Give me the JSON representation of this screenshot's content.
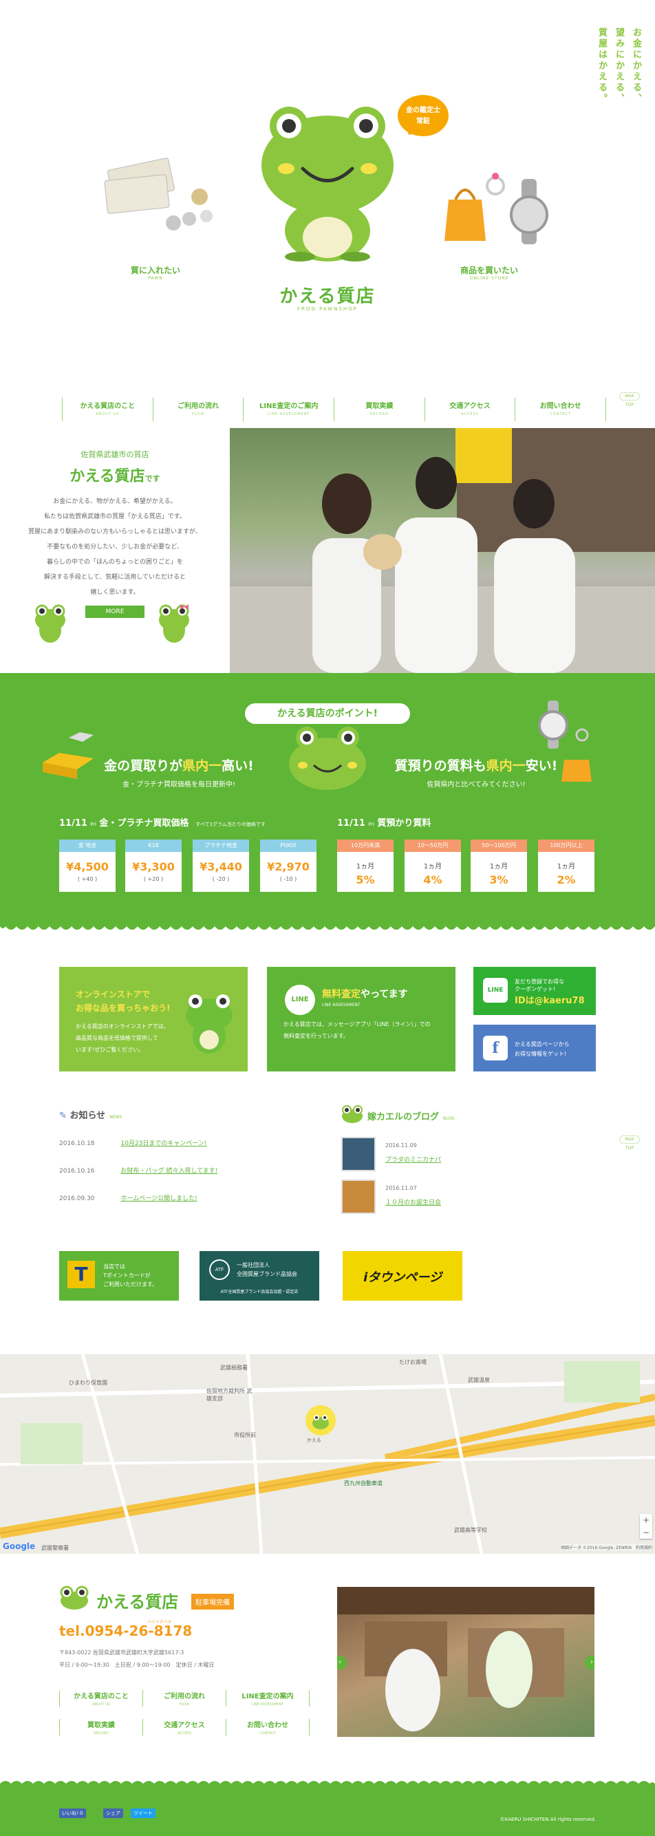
{
  "header": {
    "tagline": [
      "お金にかえる、",
      "望みにかえる、",
      "質屋はかえる。"
    ],
    "bubble": [
      "金の鑑定士",
      "常駐"
    ],
    "logo_title": "かえる質店",
    "logo_sub": "FROG PAWNSHOP",
    "left_link": {
      "label": "質に入れたい",
      "sub": "PAWN"
    },
    "right_link": {
      "label": "商品を買いたい",
      "sub": "ONLINE STORE"
    }
  },
  "nav": [
    {
      "label": "かえる質店のこと",
      "sub": "ABOUT US"
    },
    {
      "label": "ご利用の流れ",
      "sub": "FLOW"
    },
    {
      "label": "LINE査定のご案内",
      "sub": "LINE ASSESSMENT"
    },
    {
      "label": "買取実績",
      "sub": "RECORD"
    },
    {
      "label": "交通アクセス",
      "sub": "ACCESS"
    },
    {
      "label": "お問い合わせ",
      "sub": "CONTACT"
    }
  ],
  "pagetop": {
    "label": "PAGE",
    "sub": "TOP"
  },
  "intro": {
    "pre": "佐賀県武雄市の質店",
    "title": "かえる質店",
    "title_suffix": "です",
    "body": [
      "お金にかえる、物がかえる、希望がかえる。",
      "私たちは佐賀県武雄市の質屋「かえる質店」です。",
      "質屋にあまり馴染みのない方もいらっしゃるとは思いますが、",
      "不要なものを処分したい、少しお金が必要など、",
      "暮らしの中での「ほんのちょっとの困りごと」を",
      "解決する手段として、気軽に活用していただけると",
      "嬉しく思います。"
    ],
    "more": "MORE"
  },
  "points": {
    "title": "かえる質店のポイント!",
    "left": {
      "h_pre": "金の買取りが",
      "h_em": "県内一",
      "h_post": "高い!",
      "desc": "金・プラチナ買取価格を毎日更新中!"
    },
    "right": {
      "h_pre": "質預りの質料も",
      "h_em": "県内一",
      "h_post": "安い!",
      "desc": "佐賀県内と比べてみてください!"
    },
    "price_date": "11/11",
    "price_day": "Fri",
    "price_title": "金・プラチナ買取価格",
    "price_note": "すべて1グラム当たりの価格です",
    "prices": [
      {
        "label": "金 地金",
        "value": "¥4,500",
        "change": "( +40 )"
      },
      {
        "label": "K18",
        "value": "¥3,300",
        "change": "( +20 )"
      },
      {
        "label": "プラチナ地金",
        "value": "¥3,440",
        "change": "( -20 )"
      },
      {
        "label": "Pt900",
        "value": "¥2,970",
        "change": "( -10 )"
      }
    ],
    "fee_date": "11/11",
    "fee_day": "Fri",
    "fee_title": "質預かり質料",
    "fees": [
      {
        "label": "10万円未満",
        "period": "1ヵ月",
        "rate": "5%"
      },
      {
        "label": "10〜50万円",
        "period": "1ヵ月",
        "rate": "4%"
      },
      {
        "label": "50〜100万円",
        "period": "1ヵ月",
        "rate": "3%"
      },
      {
        "label": "100万円以上",
        "period": "1ヵ月",
        "rate": "2%"
      }
    ]
  },
  "banners": {
    "online": {
      "h1": "オンラインストアで",
      "h2": "お得な品を買っちゃおう!",
      "d": [
        "かえる質店のオンラインストアでは、",
        "高品質な商品を低価格で提供して",
        "います!ぜひご覧ください。"
      ]
    },
    "line": {
      "icon": "LINE",
      "h_em": "無料査定",
      "h_post": "やってます",
      "sub": "LINE ASSESSMENT",
      "d": [
        "かえる質店では、メッセージアプリ「LINE（ライン）」での",
        "無料査定を行っています。"
      ]
    },
    "line_friend": {
      "icon": "LINE",
      "t1": "友だち登録でお得な",
      "t2": "クーポンゲット!",
      "id_pre": "IDは",
      "id": "@kaeru78"
    },
    "facebook": {
      "icon": "f",
      "t1": "かえる質店ページから",
      "t2": "お得な情報をゲット!"
    }
  },
  "news": {
    "title": "お知らせ",
    "sub": "NEWS",
    "items": [
      {
        "date": "2016.10.18",
        "title": "10月23日までのキャンペーン!"
      },
      {
        "date": "2016.10.16",
        "title": "お財布・バッグ 続々入荷してます!"
      },
      {
        "date": "2016.09.30",
        "title": "ホームページ公開しました!"
      }
    ]
  },
  "blog": {
    "title": "嫁カエルのブログ",
    "sub": "BLOG",
    "items": [
      {
        "date": "2016.11.09",
        "title": "プラダのミニカナパ"
      },
      {
        "date": "2016.11.07",
        "title": "１０月のお誕生日会"
      }
    ]
  },
  "partners": {
    "tpoint": {
      "icon": "T",
      "lines": [
        "当店では",
        "Tポイントカードが",
        "ご利用いただけます。"
      ]
    },
    "atf": {
      "icon": "ATF",
      "lines": [
        "一般社団法人",
        "全国質屋ブランド品協会"
      ],
      "foot": "ATF全国質屋ブランド品協会加盟・認定店"
    },
    "itown": {
      "label": "iタウンページ"
    }
  },
  "map": {
    "labels": [
      "ひまわり保育園",
      "武雄税務署",
      "佐賀地方裁判所 武雄支部",
      "たけお斎場",
      "武雄温泉",
      "かえる",
      "西九州自動車道",
      "武雄高等学校",
      "武雄警察署",
      "市役所前",
      "Google"
    ],
    "credit": "地図データ ©2016 Google, ZENRIN　利用規約"
  },
  "footer": {
    "logo": "かえる質店",
    "badge": "駐車場完備",
    "tel": "tel.0954-26-8178",
    "tel_note": "ハイイナハチ",
    "addr": "〒843-0022 佐賀県武雄市武雄町大字武雄5617-3",
    "hours": "平日 / 9:00〜19:30　土日祝 / 9:00〜19:00　定休日 / 木曜日",
    "nav": [
      {
        "label": "かえる質店のこと",
        "sub": "ABOUT US"
      },
      {
        "label": "ご利用の流れ",
        "sub": "FLOW"
      },
      {
        "label": "LINE査定の案内",
        "sub": "LINE ASSESSMENT"
      },
      {
        "label": "買取実績",
        "sub": "RECORD"
      },
      {
        "label": "交通アクセス",
        "sub": "ACCESS"
      },
      {
        "label": "お問い合わせ",
        "sub": "CONTACT"
      }
    ],
    "prev": "‹",
    "next": "›",
    "copyright": "©KAERU SHICHITEN All rights reserved.",
    "like": "いいね! 0",
    "share": "シェア",
    "tweet": "ツイート"
  },
  "colors": {
    "brand_green": "#5fb536",
    "light_green": "#8cc63f",
    "orange": "#f39c1e",
    "yellow": "#f9e54a"
  }
}
